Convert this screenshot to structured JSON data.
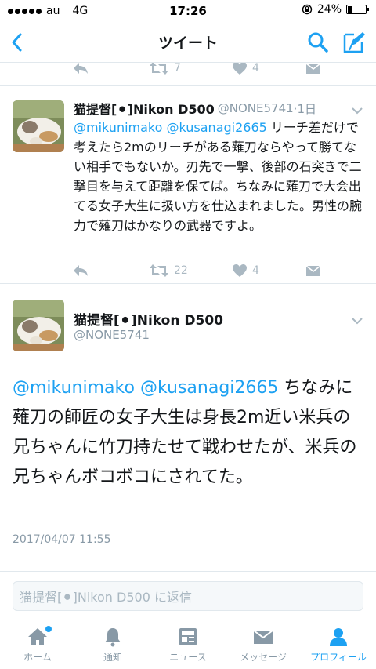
{
  "status_bar": {
    "carrier": "au",
    "network": "4G",
    "time": "17:26",
    "battery": "24%",
    "battery_level": 0.24
  },
  "nav": {
    "title": "ツイート"
  },
  "top_partial": {
    "retweets": "7",
    "likes": "4"
  },
  "reply_tweet": {
    "name": "猫提督[⚫]Nikon D500",
    "handle": "@NONE5741",
    "time": "·1日",
    "mentions": [
      "@mikunimako",
      "@kusanagi2665"
    ],
    "text": "リーチ差だけで考えたら2mのリーチがある薙刀ならやって勝てない相手でもないか。刃先で一撃、後部の石突きで二撃目を与えて距離を保てば。ちなみに薙刀で大会出てる女子大生に扱い方を仕込まれました。男性の腕力で薙刀はかなりの武器ですよ。",
    "retweets": "22",
    "likes": "4"
  },
  "focal_tweet": {
    "name": "猫提督[⚫]Nikon D500",
    "handle": "@NONE5741",
    "mentions": [
      "@mikunimako",
      "@kusanagi2665"
    ],
    "text": "ちなみに薙刀の師匠の女子大生は身長2m近い米兵の兄ちゃんに竹刀持たせて戦わせたが、米兵の兄ちゃんボコボコにされてた。",
    "date": "2017/04/07 11:55"
  },
  "reply_bar": {
    "placeholder": "猫提督[⚫]Nikon D500 に返信"
  },
  "tabs": [
    {
      "label": "ホーム",
      "icon": "home-icon"
    },
    {
      "label": "通知",
      "icon": "bell-icon"
    },
    {
      "label": "ニュース",
      "icon": "news-icon"
    },
    {
      "label": "メッセージ",
      "icon": "envelope-icon"
    },
    {
      "label": "プロフィール",
      "icon": "profile-icon"
    }
  ],
  "colors": {
    "accent": "#1da1f2",
    "muted": "#8899a6",
    "icon_gray": "#aab8c2"
  }
}
